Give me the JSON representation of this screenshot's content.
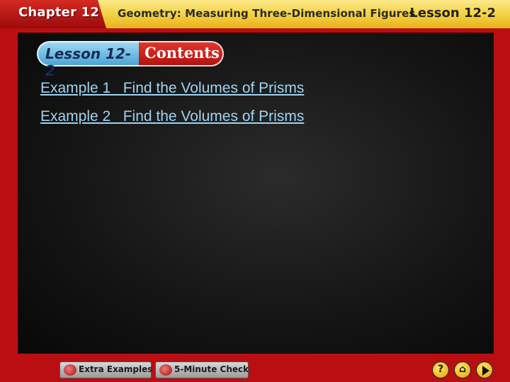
{
  "header": {
    "chapter": "Chapter 12",
    "title": "Geometry: Measuring Three-Dimensional Figures",
    "lesson": "Lesson 12-2"
  },
  "banner": {
    "lesson": "Lesson 12-2",
    "contents": "Contents"
  },
  "examples": [
    {
      "label": "Example 1   Find the Volumes of Prisms"
    },
    {
      "label": "Example 2   Find the Volumes of Prisms"
    }
  ],
  "footer": {
    "extra_examples": "Extra Examples",
    "five_minute_check": "5-Minute Check",
    "help": "?"
  },
  "colors": {
    "accent_red": "#b90f13",
    "header_gold": "#f3cf3f",
    "link_blue": "#9fd3f2",
    "panel_dark": "#141414"
  }
}
